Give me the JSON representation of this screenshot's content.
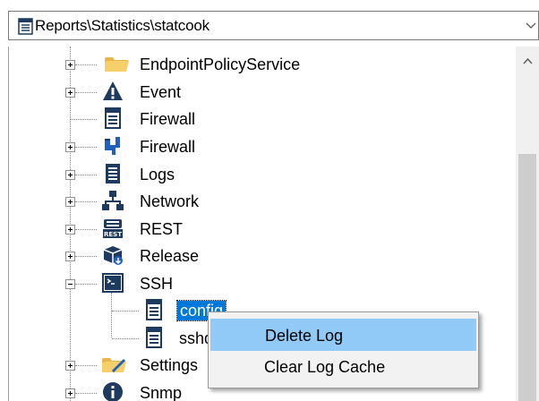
{
  "path_combo": {
    "text": "Reports\\Statistics\\statcook",
    "icon": "document-icon"
  },
  "tree": {
    "items": [
      {
        "label": "EndpointPolicyService",
        "icon": "folder-icon",
        "expander": "plus"
      },
      {
        "label": "Event",
        "icon": "warning-icon",
        "expander": "plus"
      },
      {
        "label": "Firewall",
        "icon": "document-icon",
        "expander": "none"
      },
      {
        "label": "Firewall",
        "icon": "firewall-plug-icon",
        "expander": "plus"
      },
      {
        "label": "Logs",
        "icon": "log-document-icon",
        "expander": "plus"
      },
      {
        "label": "Network",
        "icon": "network-icon",
        "expander": "plus"
      },
      {
        "label": "REST",
        "icon": "rest-api-icon",
        "expander": "plus"
      },
      {
        "label": "Release",
        "icon": "release-package-icon",
        "expander": "plus"
      },
      {
        "label": "SSH",
        "icon": "terminal-icon",
        "expander": "minus"
      },
      {
        "label": "config",
        "icon": "document-icon",
        "expander": "none",
        "selected": true
      },
      {
        "label": "sshd",
        "icon": "document-icon",
        "expander": "none"
      },
      {
        "label": "Settings",
        "icon": "settings-folder-icon",
        "expander": "plus"
      },
      {
        "label": "Snmp",
        "icon": "info-icon",
        "expander": "plus"
      }
    ]
  },
  "context_menu": {
    "items": [
      {
        "label": "Delete Log",
        "highlighted": true
      },
      {
        "label": "Clear Log Cache",
        "highlighted": false
      }
    ]
  },
  "colors": {
    "selection": "#0078d7",
    "menu_highlight": "#91c9f7",
    "menu_background": "#f2f2f2",
    "scrollbar_thumb": "#cdcdcd"
  }
}
